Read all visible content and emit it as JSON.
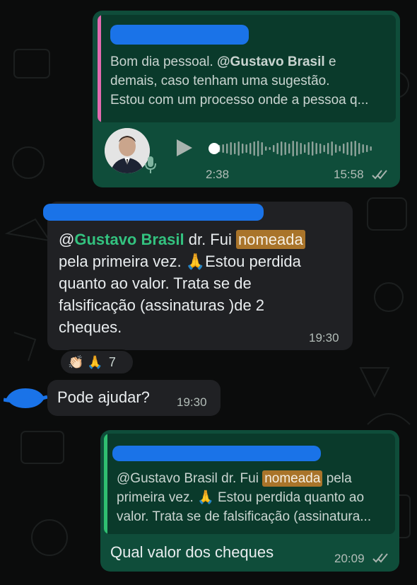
{
  "chat": {
    "msg1": {
      "quote_text": "Bom dia pessoal. @Gustavo Brasil e demais, caso tenham uma sugestão. Estou com um processo onde a pessoa q...",
      "quote_line1_pre": "Bom dia pessoal. ",
      "quote_mention": "@Gustavo Brasil",
      "quote_line1_post": " e",
      "quote_line2": "demais, caso tenham uma sugestão.",
      "quote_line3": "Estou com um processo onde a pessoa q...",
      "voice_duration": "2:38",
      "time": "15:58",
      "voice_progress": 0
    },
    "msg2": {
      "at": "@",
      "mention": "Gustavo Brasil",
      "line1_post": " dr. Fui ",
      "highlight": "nomeada",
      "line2": "pela primeira vez. 🙏Estou perdida",
      "line3": "quanto ao valor. Trata se de",
      "line4": "falsificação (assinaturas )de 2",
      "line5": "cheques.",
      "time": "19:30",
      "reactions": "👏🏻 🙏",
      "reaction_count": "7"
    },
    "msg3": {
      "text": "Pode ajudar?",
      "time": "19:30"
    },
    "msg4": {
      "quote_mention": "@Gustavo Brasil",
      "quote_line1_mid": " dr. Fui ",
      "quote_highlight": "nomeada",
      "quote_line1_post": " pela",
      "quote_line2": "primeira vez. 🙏 Estou perdida quanto ao",
      "quote_line3": "valor. Trata se de falsificação (assinatura...",
      "text": "Qual valor dos cheques",
      "time": "20:09"
    }
  },
  "colors": {
    "outgoing_bubble": "#0f4d3a",
    "incoming_bubble": "#202124",
    "mention_green": "#33c27f",
    "highlight": "#a9742a",
    "redaction_blue": "#1a73e8",
    "quote_bar_pink": "#e36ab0",
    "quote_bar_green": "#2fbf71"
  }
}
